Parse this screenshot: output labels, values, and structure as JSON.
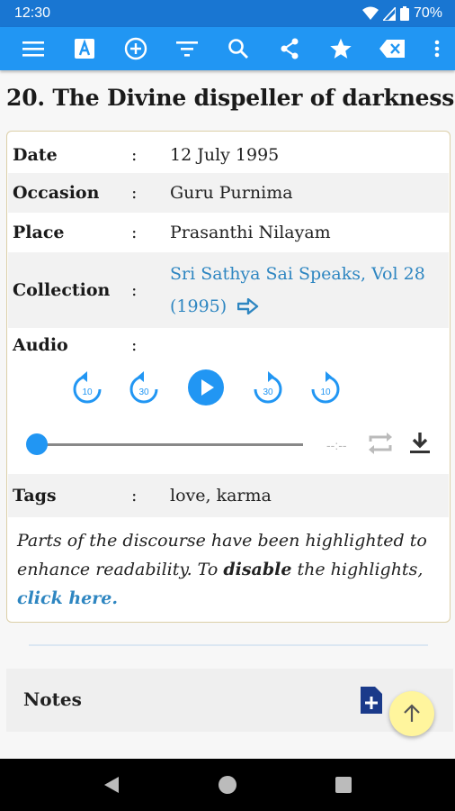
{
  "status": {
    "time": "12:30",
    "battery": "70%"
  },
  "toolbar": {
    "icons": [
      "menu-icon",
      "font-icon",
      "add-circle-icon",
      "filter-icon",
      "search-icon",
      "share-icon",
      "star-icon",
      "backspace-icon",
      "more-icon"
    ]
  },
  "article": {
    "title": "20. The Divine dispeller of darkness"
  },
  "details": {
    "date_label": "Date",
    "date_value": "12 July 1995",
    "occasion_label": "Occasion",
    "occasion_value": "Guru Purnima",
    "place_label": "Place",
    "place_value": "Prasanthi Nilayam",
    "collection_label": "Collection",
    "collection_line1": "Sri Sathya Sai Speaks, Vol 28",
    "collection_line2": "(1995)",
    "audio_label": "Audio",
    "tags_label": "Tags",
    "tags_value": "love, karma",
    "colon": ":"
  },
  "audio": {
    "rewind_10": "10",
    "rewind_30": "30",
    "forward_30": "30",
    "forward_10": "10",
    "time_display": "--:--",
    "progress": 0
  },
  "highlight_note": {
    "part1": "Parts of the discourse have been highlighted to enhance readability. To ",
    "bold": "disable",
    "part2": " the highlights, ",
    "link": "click here",
    "end": "."
  },
  "notes": {
    "label": "Notes"
  },
  "colors": {
    "primary": "#2196f3",
    "statusbar": "#1976d2",
    "link": "#2e86c1",
    "fab": "#fff59d",
    "player": "#2196f3"
  }
}
